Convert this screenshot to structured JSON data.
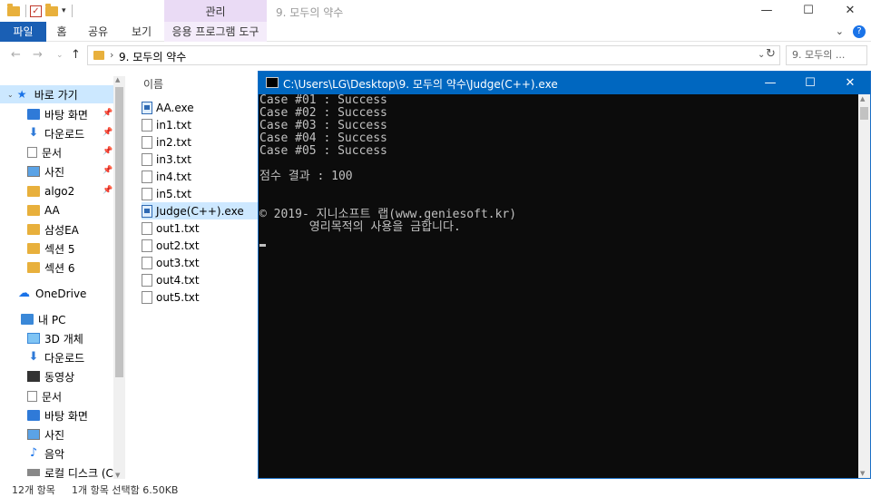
{
  "explorer": {
    "title": "9. 모두의 약수",
    "contextual_tab_header": "관리",
    "window_controls": {
      "minimize": "—",
      "maximize": "☐",
      "close": "✕"
    },
    "ribbon_tabs": {
      "file": "파일",
      "home": "홈",
      "share": "공유",
      "view": "보기",
      "app_tools": "응용 프로그램 도구"
    },
    "ribbon_right": {
      "collapse": "⌄",
      "help": "?"
    },
    "address": {
      "back": "←",
      "forward": "→",
      "history": "⌄",
      "up": "↑",
      "crumb_sep": "›",
      "crumb": "9. 모두의 약수",
      "dropdown": "⌄",
      "refresh": "↻",
      "search_placeholder": "9. 모두의 ..."
    },
    "nav_pane": {
      "quick_access": "바로 가기",
      "items": [
        {
          "label": "바탕 화면",
          "pinned": true
        },
        {
          "label": "다운로드",
          "pinned": true
        },
        {
          "label": "문서",
          "pinned": true
        },
        {
          "label": "사진",
          "pinned": true
        },
        {
          "label": "algo2",
          "pinned": true
        },
        {
          "label": "AA",
          "pinned": false
        },
        {
          "label": "삼성EA",
          "pinned": false
        },
        {
          "label": "섹션 5",
          "pinned": false
        },
        {
          "label": "섹션 6",
          "pinned": false
        }
      ],
      "onedrive": "OneDrive",
      "this_pc": "내 PC",
      "pc_items": [
        {
          "label": "3D 개체"
        },
        {
          "label": "다운로드"
        },
        {
          "label": "동영상"
        },
        {
          "label": "문서"
        },
        {
          "label": "바탕 화면"
        },
        {
          "label": "사진"
        },
        {
          "label": "음악"
        },
        {
          "label": "로컬 디스크 (C:)"
        }
      ]
    },
    "file_list": {
      "column_name": "이름",
      "files": [
        {
          "name": "AA.exe",
          "type": "exe",
          "selected": false
        },
        {
          "name": "in1.txt",
          "type": "txt",
          "selected": false
        },
        {
          "name": "in2.txt",
          "type": "txt",
          "selected": false
        },
        {
          "name": "in3.txt",
          "type": "txt",
          "selected": false
        },
        {
          "name": "in4.txt",
          "type": "txt",
          "selected": false
        },
        {
          "name": "in5.txt",
          "type": "txt",
          "selected": false
        },
        {
          "name": "Judge(C++).exe",
          "type": "exe",
          "selected": true
        },
        {
          "name": "out1.txt",
          "type": "txt",
          "selected": false
        },
        {
          "name": "out2.txt",
          "type": "txt",
          "selected": false
        },
        {
          "name": "out3.txt",
          "type": "txt",
          "selected": false
        },
        {
          "name": "out4.txt",
          "type": "txt",
          "selected": false
        },
        {
          "name": "out5.txt",
          "type": "txt",
          "selected": false
        }
      ]
    },
    "status": {
      "count": "12개 항목",
      "selection": "1개 항목 선택함 6.50KB"
    }
  },
  "console": {
    "title": "C:\\Users\\LG\\Desktop\\9. 모두의 약수\\Judge(C++).exe",
    "window_controls": {
      "minimize": "—",
      "maximize": "☐",
      "close": "✕"
    },
    "lines": [
      "Case #01 : Success",
      "Case #02 : Success",
      "Case #03 : Success",
      "Case #04 : Success",
      "Case #05 : Success",
      "",
      "점수 결과 : 100",
      "",
      "",
      "© 2019- 지니소프트 랩(www.geniesoft.kr)",
      "       영리목적의 사용을 금합니다.",
      ""
    ]
  },
  "colors": {
    "file_tab": "#1a5fb4",
    "contextual_tab": "#eadbf5",
    "console_title": "#0067c0",
    "console_bg": "#0c0c0c",
    "console_text": "#c0c0c0",
    "selection": "#cde8ff"
  }
}
